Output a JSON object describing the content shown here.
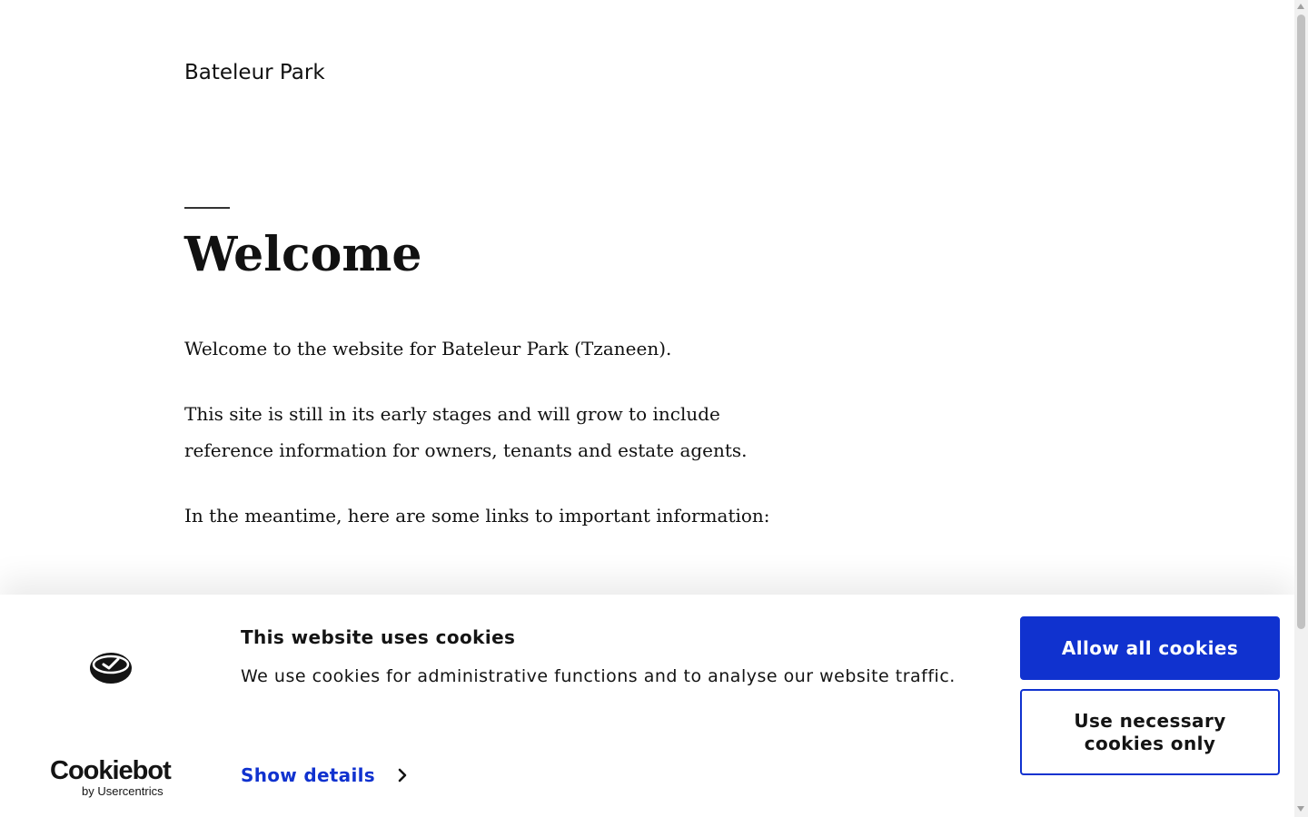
{
  "site": {
    "title": "Bateleur Park"
  },
  "main": {
    "heading": "Welcome",
    "paragraphs": [
      "Welcome to the website for Bateleur Park (Tzaneen).",
      "This site is still in its early stages and will grow to include reference information for owners, tenants and estate agents.",
      "In the meantime, here are some links to important information:"
    ]
  },
  "cookie_banner": {
    "title": "This website uses cookies",
    "text": "We use cookies for administrative functions and to analyse our website traffic.",
    "show_details_label": "Show details",
    "allow_all_label": "Allow all cookies",
    "necessary_only_label": "Use necessary cookies only",
    "brand_name": "Cookiebot",
    "brand_sub": "by Usercentrics",
    "icons": {
      "logo": "cookie-check-icon",
      "details": "chevron-right-icon"
    },
    "colors": {
      "accent": "#1032cf",
      "text": "#141414",
      "background": "#ffffff"
    }
  }
}
